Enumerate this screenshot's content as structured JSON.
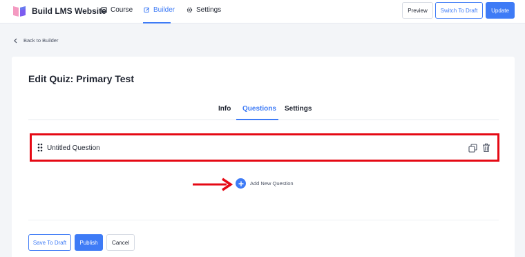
{
  "header": {
    "app_title": "Build LMS Website",
    "nav": [
      {
        "label": "Course",
        "icon": "course-icon"
      },
      {
        "label": "Builder",
        "icon": "edit-icon",
        "active": true
      },
      {
        "label": "Settings",
        "icon": "gear-icon"
      }
    ],
    "actions": {
      "preview": "Preview",
      "switch_to_draft": "Switch To Draft",
      "update": "Update"
    }
  },
  "back_link": "Back to Builder",
  "quiz": {
    "title": "Edit Quiz: Primary Test",
    "tabs": [
      {
        "label": "Info"
      },
      {
        "label": "Questions",
        "active": true
      },
      {
        "label": "Settings"
      }
    ],
    "questions": [
      {
        "title": "Untitled Question"
      }
    ],
    "add_question_label": "Add New Question"
  },
  "footer": {
    "save_draft": "Save To Draft",
    "publish": "Publish",
    "cancel": "Cancel"
  },
  "colors": {
    "accent": "#3e7bf6",
    "highlight": "#e50914",
    "logo_pink": "#f49ac1",
    "logo_blue": "#5b8def"
  }
}
